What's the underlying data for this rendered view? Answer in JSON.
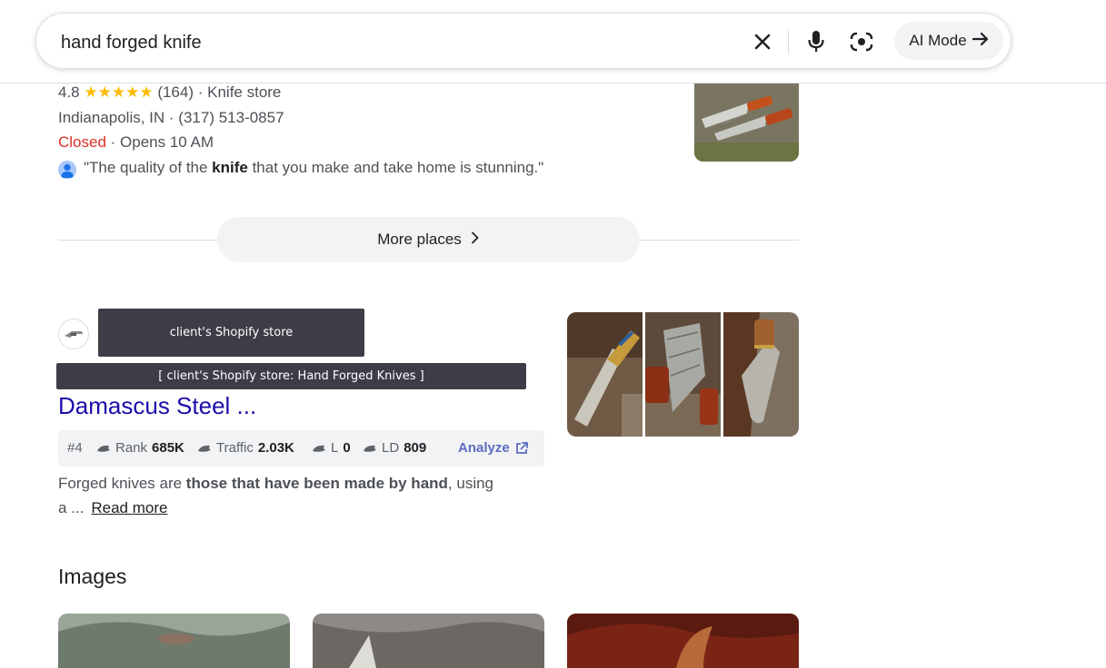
{
  "search": {
    "query": "hand forged knife",
    "ai_mode_label": "AI Mode"
  },
  "local_result": {
    "rating": "4.8",
    "stars": "★★★★★",
    "reviews": "(164)",
    "category": "· Knife store",
    "address_line": "Indianapolis, IN · (317) 513-0857",
    "status": "Closed",
    "hours": "· Opens 10 AM",
    "review_pre": "\"The quality of the ",
    "review_bold": "knife",
    "review_post": " that you make and take home is stunning.\""
  },
  "more_places": {
    "label": "More places"
  },
  "web_result": {
    "overlay_store": "client's Shopify store",
    "overlay_title": "[ client's Shopify store: Hand Forged Knives ]",
    "title": "Damascus Steel ...",
    "seo": {
      "position": "#4",
      "rank_label": "Rank",
      "rank_value": "685K",
      "traffic_label": "Traffic",
      "traffic_value": "2.03K",
      "l_label": "L",
      "l_value": "0",
      "ld_label": "LD",
      "ld_value": "809",
      "analyze_label": "Analyze"
    },
    "snippet_pre": "Forged knives are ",
    "snippet_bold": "those that have been made by hand",
    "snippet_post": ", using",
    "snippet_line2": "a ...",
    "read_more": "Read more"
  },
  "images_section": {
    "heading": "Images"
  },
  "colors": {
    "link": "#1a0dab",
    "closed": "#d93025",
    "star": "#fbbc04",
    "overlay_bg": "#3c3d47",
    "analyze": "#5c6bc0"
  },
  "icons": [
    "close-icon",
    "microphone-icon",
    "lens-icon",
    "arrow-right-icon",
    "chevron-right-icon",
    "external-link-icon",
    "semrush-icon",
    "person-icon"
  ]
}
